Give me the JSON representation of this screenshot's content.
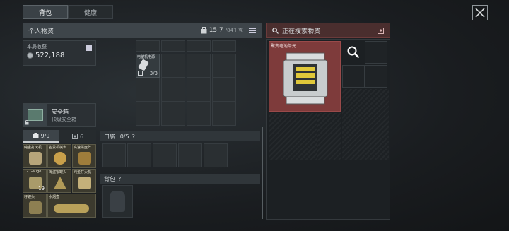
{
  "tabs": [
    {
      "label": "背包",
      "active": true
    },
    {
      "label": "健康",
      "active": false
    }
  ],
  "left_panel": {
    "title": "个人物资",
    "weight": "15.7",
    "weight_max": "/84千克"
  },
  "right_panel": {
    "title": "正在搜索物资"
  },
  "income": {
    "label": "本局收获",
    "value": "522,188"
  },
  "safebox": {
    "name": "安全箱",
    "subtitle": "顶级安全箱"
  },
  "safe_tabs": [
    {
      "label": "9/9",
      "icon": "briefcase-icon"
    },
    {
      "label": "6",
      "icon": "safe-icon"
    }
  ],
  "safe_items": [
    {
      "name": "纯金打火机",
      "color": "#b7a57a"
    },
    {
      "name": "名贵机械表",
      "color": "#c9a04a"
    },
    {
      "name": "高速磁盘阵",
      "color": "#9f7d3b"
    },
    {
      "name": "12 Gauge",
      "color": "#a99b6a",
      "count": "19"
    },
    {
      "name": "海盗银罐头",
      "color": "#b19a58"
    },
    {
      "name": "纯金打火机",
      "color": "#c4b07a"
    },
    {
      "name": "籽镜头",
      "color": "#8d7f52"
    },
    {
      "name": "水烟壶",
      "color": "#b9a15a"
    }
  ],
  "battery_item": {
    "name": "电脑机电源",
    "count": "3/3"
  },
  "pocket": {
    "label": "口袋:",
    "count": "0/5",
    "help": "?"
  },
  "backpack": {
    "label": "背包",
    "help": "?"
  },
  "found_item": {
    "name": "聚变电池单元"
  }
}
